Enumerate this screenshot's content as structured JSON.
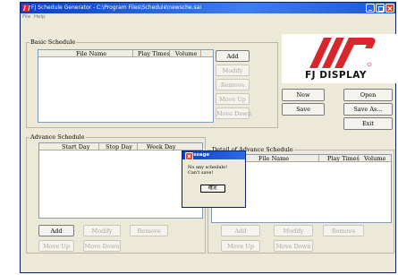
{
  "window": {
    "title": "FJ Schedule Generator - C:\\Program Files\\Schedule\\newsche.sai",
    "menus": [
      "File",
      "Help"
    ]
  },
  "basic_schedule": {
    "label": "Basic Schedule",
    "columns": [
      "File Name",
      "Play Times",
      "Volume"
    ],
    "buttons": {
      "add": "Add",
      "modify": "Modify",
      "remove": "Remove",
      "move_up": "Move Up",
      "move_down": "Move Down"
    }
  },
  "logo": {
    "text": "FJ DISPLAY",
    "color": "#d9262c"
  },
  "file_buttons": {
    "new": "New",
    "open": "Open",
    "save": "Save",
    "save_as": "Save As...",
    "exit": "Exit"
  },
  "advance_schedule": {
    "label": "Advance Schedule",
    "columns": [
      "Start Day",
      "Stop Day",
      "Week Day"
    ],
    "buttons": {
      "add": "Add",
      "modify": "Modify",
      "remove": "Remove",
      "move_up": "Move Up",
      "move_down": "Move Down"
    }
  },
  "detail_schedule": {
    "label": "Detail of Advance Schedule",
    "columns": [
      "File Name",
      "Play Times",
      "Volume"
    ],
    "buttons": {
      "add": "Add",
      "modify": "Modify",
      "remove": "Remove",
      "move_up": "Move Up",
      "move_down": "Move Down"
    }
  },
  "message_dialog": {
    "title": "Message",
    "line1": "No any schedule!",
    "line2": "Can't save!",
    "ok_label": "確定"
  }
}
